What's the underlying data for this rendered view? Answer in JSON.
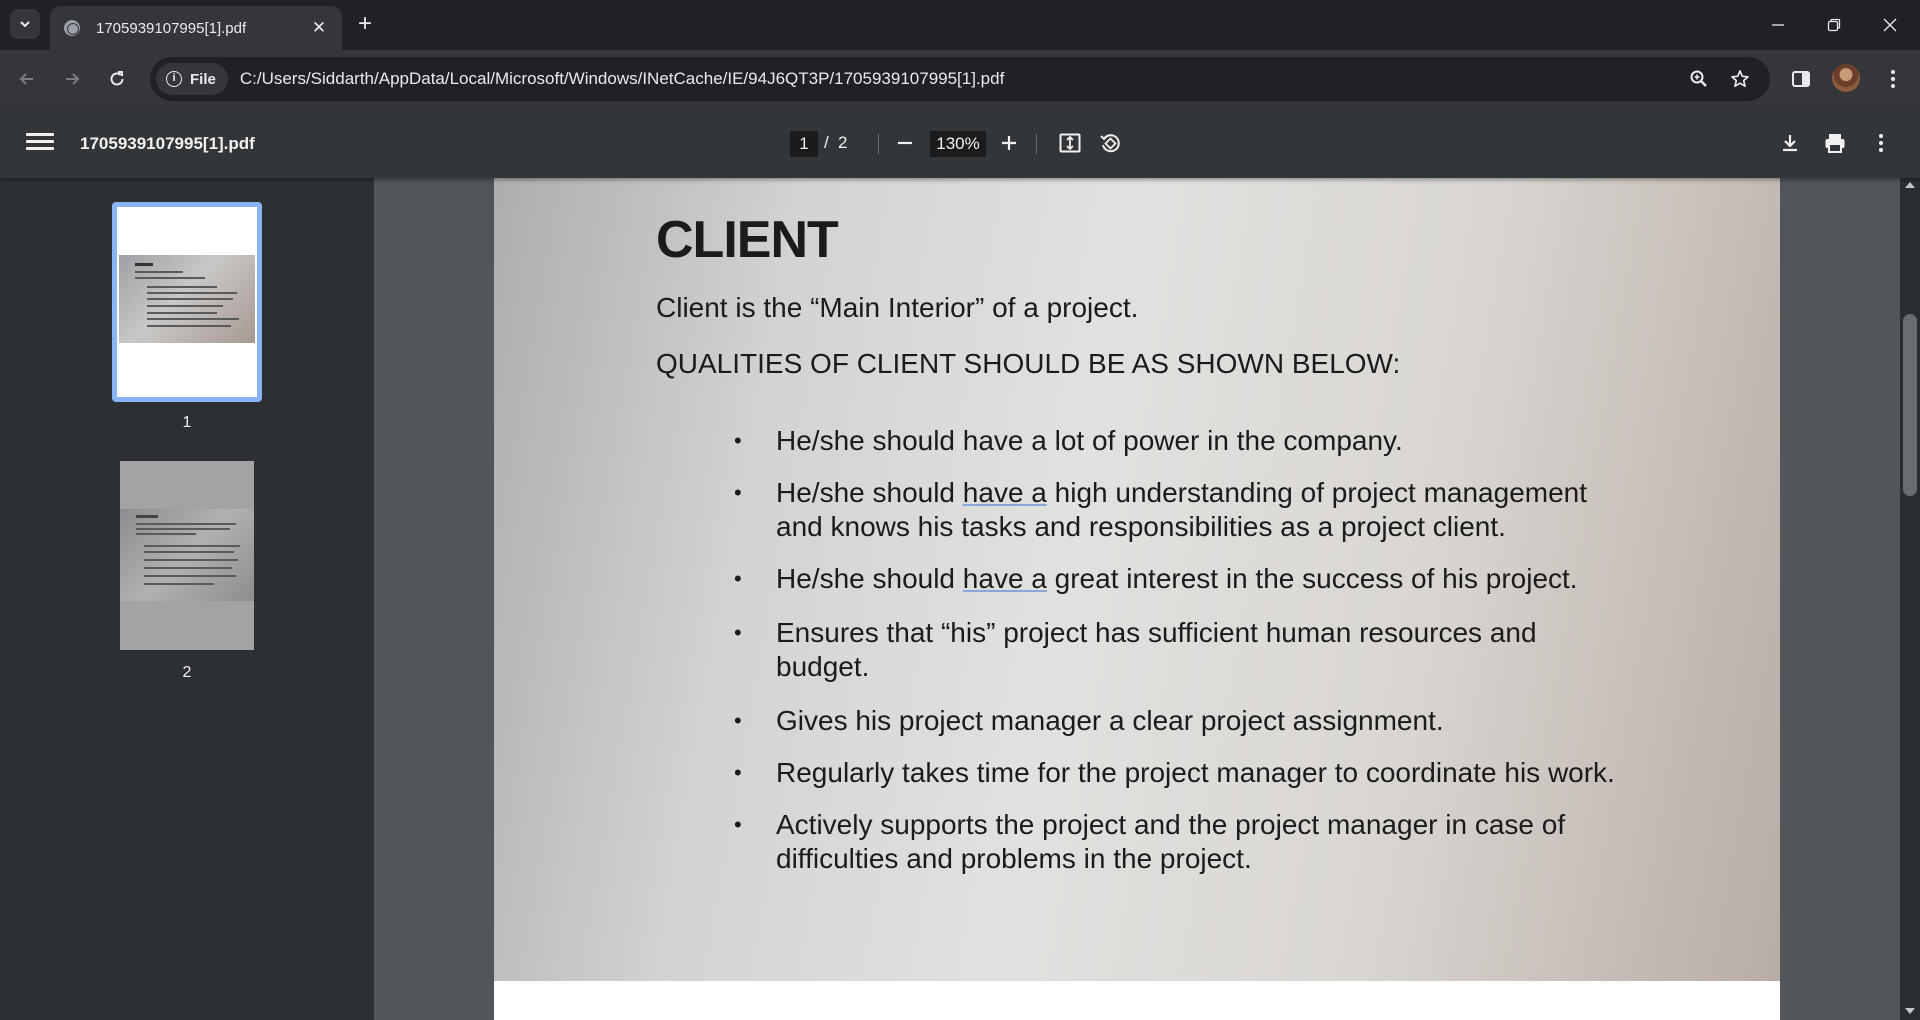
{
  "browser": {
    "tab_title": "1705939107995[1].pdf",
    "tab_close": "✕",
    "new_tab": "+",
    "file_chip": "File",
    "url": "C:/Users/Siddarth/AppData/Local/Microsoft/Windows/INetCache/IE/94J6QT3P/1705939107995[1].pdf"
  },
  "pdf_toolbar": {
    "file_name": "1705939107995[1].pdf",
    "current_page": "1",
    "page_separator": "/",
    "total_pages": "2",
    "zoom": "130%"
  },
  "thumbnails": [
    {
      "label": "1",
      "selected": true
    },
    {
      "label": "2",
      "selected": false
    }
  ],
  "document": {
    "heading": "CLIENT",
    "intro": "Client is the “Main Interior” of a project.",
    "subheading": "QUALITIES OF CLIENT SHOULD BE AS SHOWN BELOW:",
    "bullets": [
      {
        "line1": "He/she should have a lot of power in the company."
      },
      {
        "line1_pre": "He/she should ",
        "line1_ul": "have  a",
        "line1_post": " high understanding of project management",
        "line2": "and knows his tasks and responsibilities as a project client."
      },
      {
        "line1_pre": "He/she should ",
        "line1_ul": "have  a",
        "line1_post": " great interest in the success of his project."
      },
      {
        "line1": "Ensures that “his” project has sufficient human resources and",
        "line2": "budget."
      },
      {
        "line1": "Gives his project manager a clear project assignment."
      },
      {
        "line1": "Regularly takes time for the project manager to coordinate his work."
      },
      {
        "line1": "Actively supports the project and the project manager in case of",
        "line2": "difficulties and problems in the project."
      }
    ]
  },
  "colors": {
    "accent": "#8ab4f8",
    "chrome_dark": "#202124",
    "chrome_toolbar": "#35363a",
    "pdf_bar": "#323639",
    "viewer_bg": "#525659"
  },
  "icons": {
    "tab_search": "chevron-down-icon",
    "back": "arrow-left-icon",
    "forward": "arrow-right-icon",
    "reload": "reload-icon",
    "zoom": "zoom-icon",
    "bookmark": "star-icon",
    "sidepanel": "side-panel-icon",
    "menu": "kebab-icon",
    "download": "download-icon",
    "print": "print-icon",
    "fit": "fit-page-icon",
    "rotate": "rotate-icon"
  }
}
